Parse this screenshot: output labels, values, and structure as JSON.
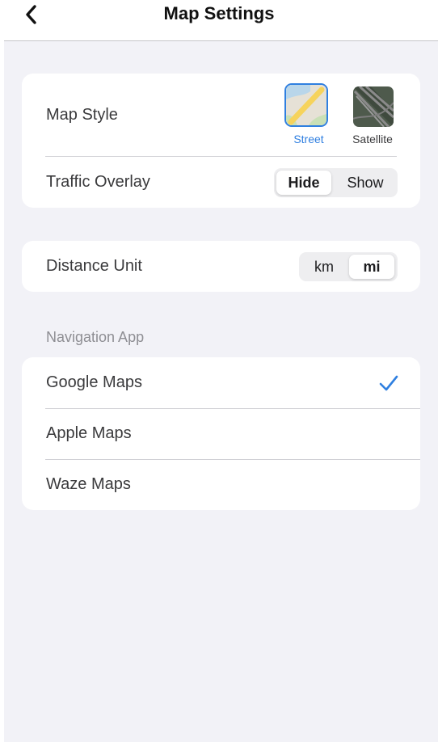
{
  "header": {
    "title": "Map Settings",
    "back_icon": "chevron-left-icon"
  },
  "map_card": {
    "map_style_label": "Map Style",
    "style_options": [
      {
        "label": "Street",
        "selected": true,
        "icon": "street-map-thumbnail"
      },
      {
        "label": "Satellite",
        "selected": false,
        "icon": "satellite-map-thumbnail"
      }
    ],
    "traffic_label": "Traffic Overlay",
    "traffic_options": [
      "Hide",
      "Show"
    ],
    "traffic_selected": "Hide"
  },
  "distance_card": {
    "label": "Distance Unit",
    "options": [
      "km",
      "mi"
    ],
    "selected": "mi"
  },
  "navigation": {
    "header": "Navigation App",
    "items": [
      {
        "label": "Google Maps",
        "checked": true
      },
      {
        "label": "Apple Maps",
        "checked": false
      },
      {
        "label": "Waze Maps",
        "checked": false
      }
    ],
    "check_icon": "checkmark-icon"
  },
  "colors": {
    "accent": "#2f7fe0",
    "background": "#f2f2f7",
    "card": "#ffffff",
    "secondary_text": "#8e8e93"
  }
}
